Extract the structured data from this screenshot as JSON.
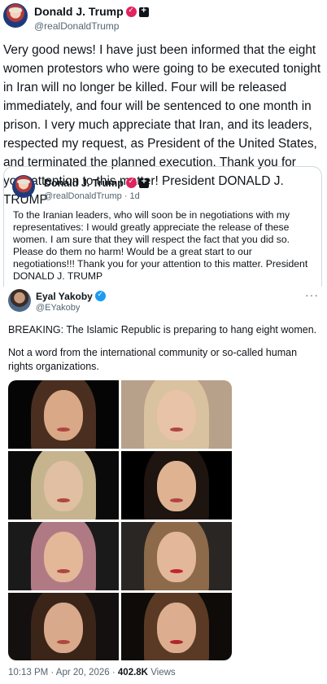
{
  "main_post": {
    "author_name": "Donald J. Trump",
    "author_handle": "@realDonaldTrump",
    "text": "Very good news! I have just been informed that the eight women protestors who were going to be executed tonight in Iran will no longer be killed. Four will be released immediately, and four will be sentenced to one month in prison. I very much appreciate that Iran, and its leaders, respected my request, as President of the United States, and terminated the planned execution. Thank you for your attention to this matter! President DONALD J. TRUMP"
  },
  "quoted_post": {
    "author_name": "Donald J. Trump",
    "author_handle": "@realDonaldTrump",
    "separator": "·",
    "time_ago": "1d",
    "text": "To the Iranian leaders, who will soon be in negotiations with my representatives: I would greatly appreciate the release of these women. I am sure that they will respect the fact that you did so. Please do them no harm! Would be a great start to our negotiations!!! Thank you for your attention to this matter. President DONALD J. TRUMP"
  },
  "nested_post": {
    "author_name": "Eyal Yakoby",
    "author_handle": "@EYakoby",
    "more_label": "···",
    "paragraph_1": "BREAKING: The Islamic Republic is preparing to hang eight women.",
    "paragraph_2": "Not a word from the international community or so-called human rights organizations.",
    "image_count": 8
  },
  "footer": {
    "timestamp": "10:13 PM · Apr 20, 2026 ·",
    "views_count": "402.8K",
    "views_label": "Views"
  },
  "colors": {
    "text_primary": "#0f1419",
    "text_secondary": "#536471",
    "border": "#cfd9de",
    "verified_pink": "#e0245e",
    "verified_blue": "#1d9bf0"
  },
  "icons": [
    "verified-badge-icon",
    "affiliate-badge-icon",
    "more-options-icon"
  ]
}
